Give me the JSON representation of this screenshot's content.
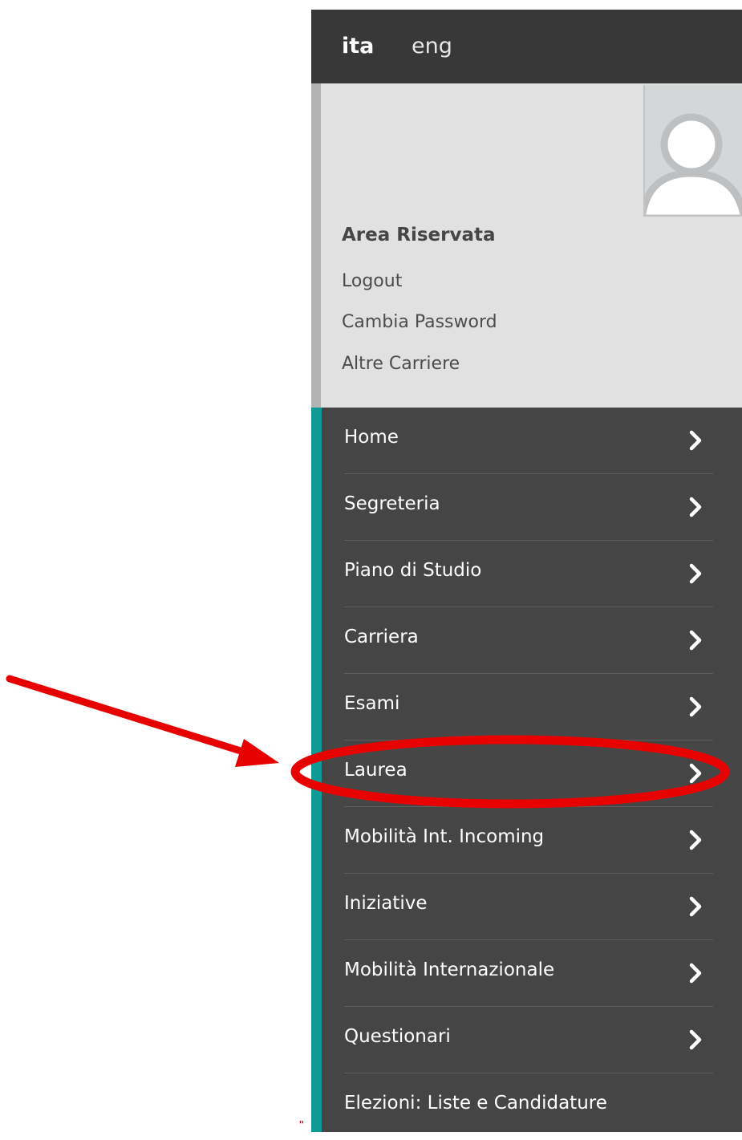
{
  "languages": {
    "ita": "ita",
    "eng": "eng"
  },
  "user": {
    "title": "Area Riservata",
    "links": [
      "Logout",
      "Cambia Password",
      "Altre Carriere"
    ]
  },
  "menu": {
    "items": [
      {
        "label": "Home"
      },
      {
        "label": "Segreteria"
      },
      {
        "label": "Piano di Studio"
      },
      {
        "label": "Carriera"
      },
      {
        "label": "Esami"
      },
      {
        "label": "Laurea"
      },
      {
        "label": "Mobilità Int. Incoming"
      },
      {
        "label": "Iniziative"
      },
      {
        "label": "Mobilità Internazionale"
      },
      {
        "label": "Questionari"
      },
      {
        "label": "Elezioni: Liste e Candidature"
      }
    ]
  },
  "annotation": {
    "color": "#e60000",
    "highlighted_item": "Laurea",
    "stray_mark": "\""
  },
  "colors": {
    "lang_bar": "#383838",
    "user_box": "#e1e1e1",
    "menu_bg": "#454545",
    "accent": "#0e9b96"
  },
  "icons": {
    "avatar": "user-silhouette-icon",
    "chevron": "chevron-right-icon"
  }
}
